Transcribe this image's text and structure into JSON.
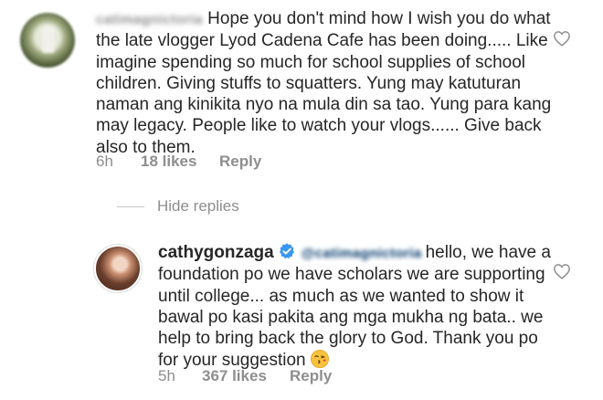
{
  "comment1": {
    "username": "catimagnictoria",
    "lines": [
      "Hope you don't mind how I wish you do what",
      "the late vlogger Lyod  Cadena Cafe has been doing..... Like",
      "imagine spending so much for school supplies of school",
      "children. Giving stuffs to squatters. Yung may katuturan",
      "naman ang kinikita nyo na mula din sa tao. Yung para kang",
      "may legacy. People like to watch your vlogs...... Give back",
      "also to them."
    ],
    "time": "6h",
    "likes": "18 likes",
    "reply_label": "Reply"
  },
  "replies": {
    "hide_label": "Hide replies"
  },
  "comment2": {
    "username": "cathygonzaga",
    "mention": "@catimagnictoria",
    "first_line_text": "hello, we have a",
    "lines": [
      "foundation po we have scholars we are supporting",
      "until college... as much as we wanted to show it",
      "bawal po kasi pakita ang mga mukha ng bata.. we",
      "help to bring back the glory to God. Thank you po",
      "for your suggestion"
    ],
    "emoji": "face-blowing-a-kiss",
    "time": "5h",
    "likes": "367 likes",
    "reply_label": "Reply"
  },
  "colors": {
    "text": "#262626",
    "secondary": "#8e8e8e",
    "verified": "#3897f0",
    "divider": "#c7c7c7"
  },
  "icons": [
    "heart-outline-icon",
    "verified-badge-icon",
    "kiss-emoji-icon"
  ]
}
